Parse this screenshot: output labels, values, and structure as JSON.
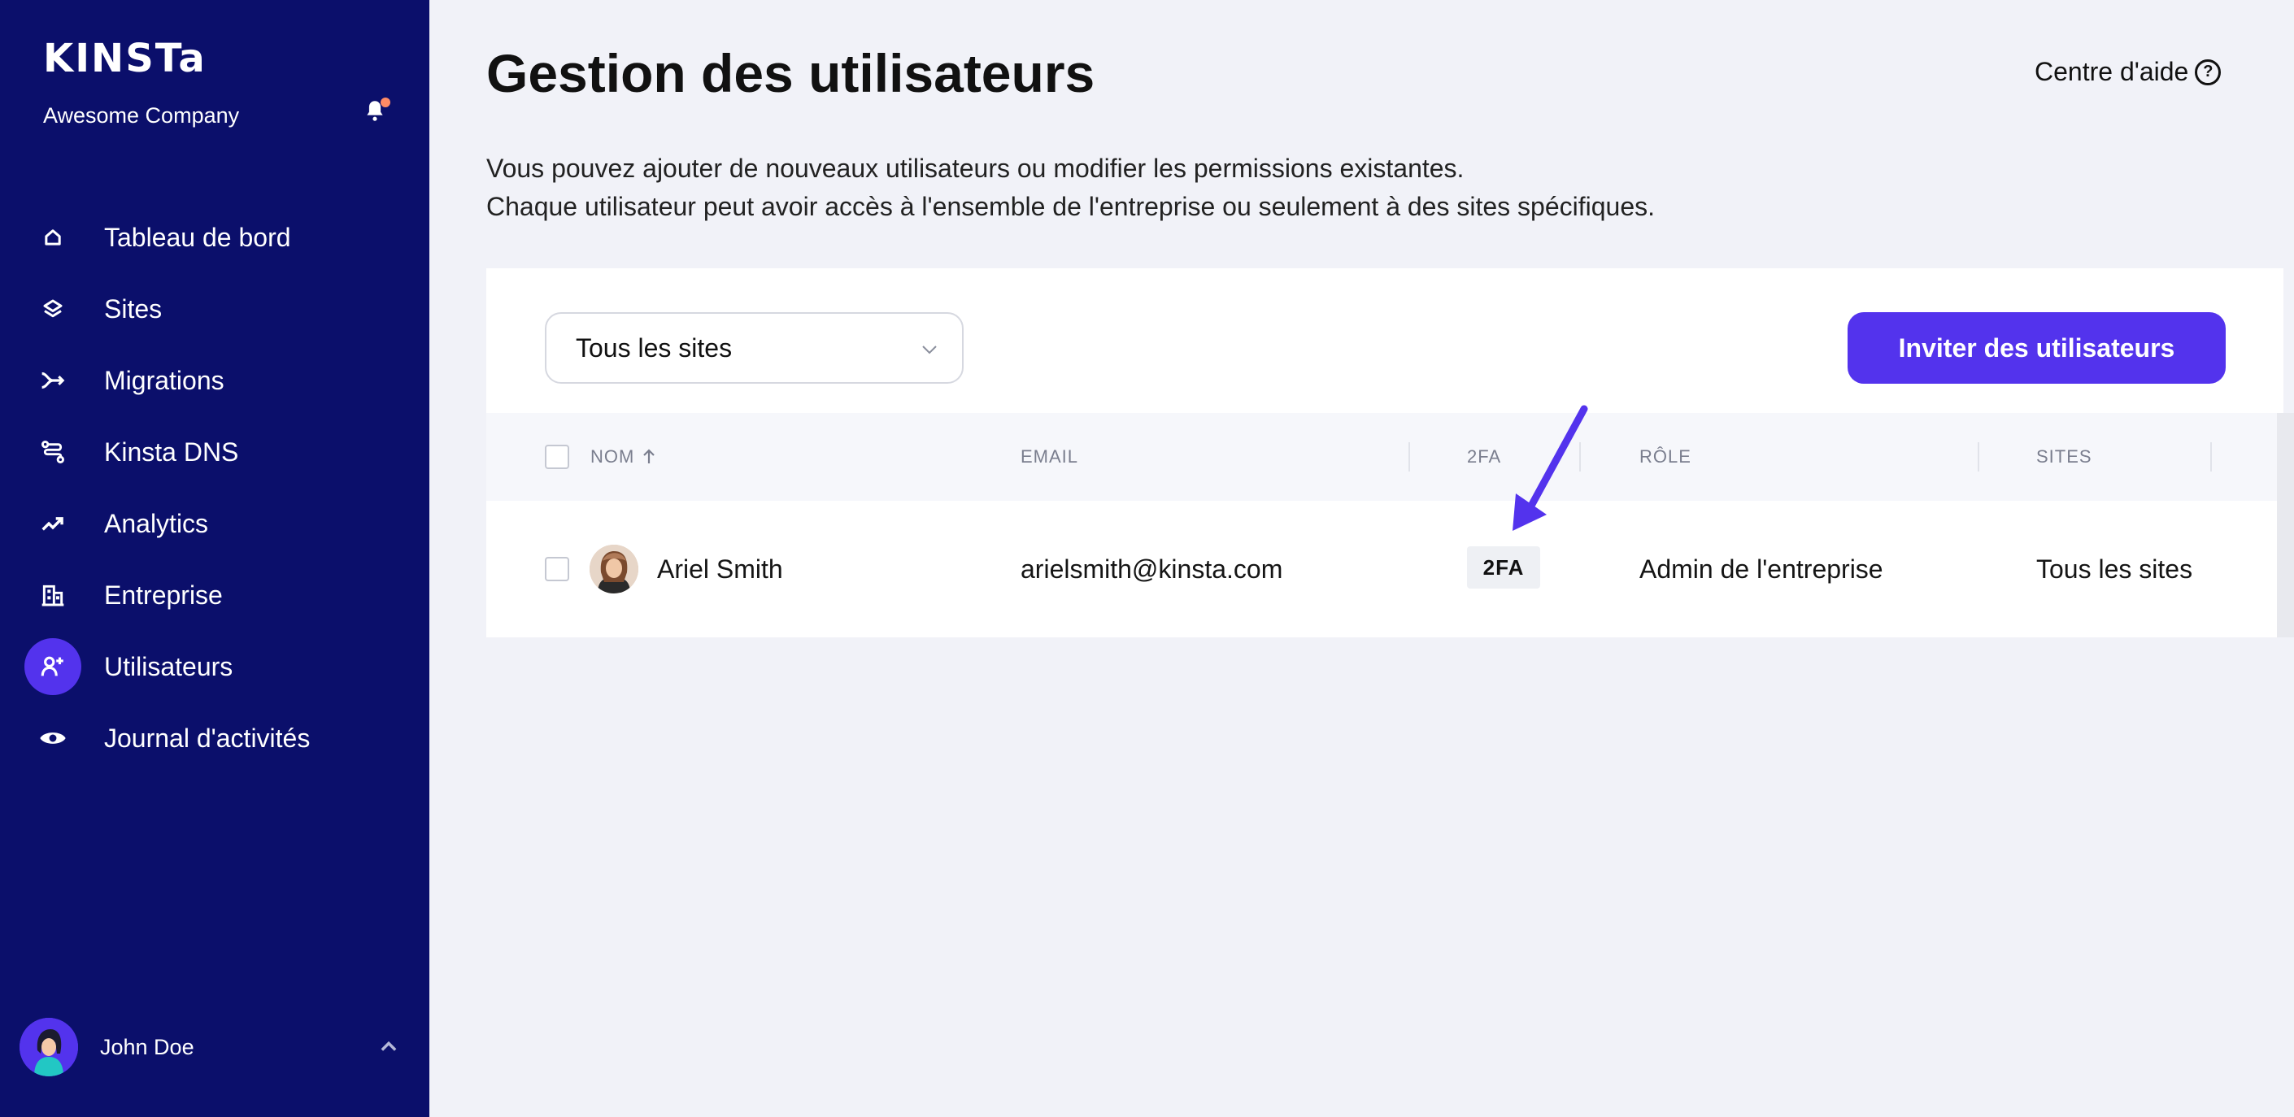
{
  "sidebar": {
    "logo": "KINSTa",
    "company": "Awesome Company",
    "items": [
      {
        "label": "Tableau de bord",
        "icon": "home-icon"
      },
      {
        "label": "Sites",
        "icon": "layers-icon"
      },
      {
        "label": "Migrations",
        "icon": "migrate-icon"
      },
      {
        "label": "Kinsta DNS",
        "icon": "dns-icon"
      },
      {
        "label": "Analytics",
        "icon": "trend-icon"
      },
      {
        "label": "Entreprise",
        "icon": "building-icon"
      },
      {
        "label": "Utilisateurs",
        "icon": "add-user-icon",
        "active": true
      },
      {
        "label": "Journal d'activités",
        "icon": "eye-icon"
      }
    ],
    "user_name": "John Doe"
  },
  "header": {
    "title": "Gestion des utilisateurs",
    "help": "Centre d'aide"
  },
  "description": {
    "line1": "Vous pouvez ajouter de nouveaux utilisateurs ou modifier les permissions existantes.",
    "line2": "Chaque utilisateur peut avoir accès à l'ensemble de l'entreprise ou seulement à des sites spécifiques."
  },
  "toolbar": {
    "site_filter": "Tous les sites",
    "invite_label": "Inviter des utilisateurs"
  },
  "table": {
    "columns": {
      "name": "NOM",
      "email": "EMAIL",
      "twofa": "2FA",
      "role": "RÔLE",
      "sites": "SITES"
    },
    "rows": [
      {
        "name": "Ariel Smith",
        "email": "arielsmith@kinsta.com",
        "twofa": "2FA",
        "role": "Admin de l'entreprise",
        "sites": "Tous les sites"
      }
    ]
  },
  "colors": {
    "sidebar_bg": "#0b0f6b",
    "accent": "#5333ed",
    "page_bg": "#f1f2f8"
  }
}
